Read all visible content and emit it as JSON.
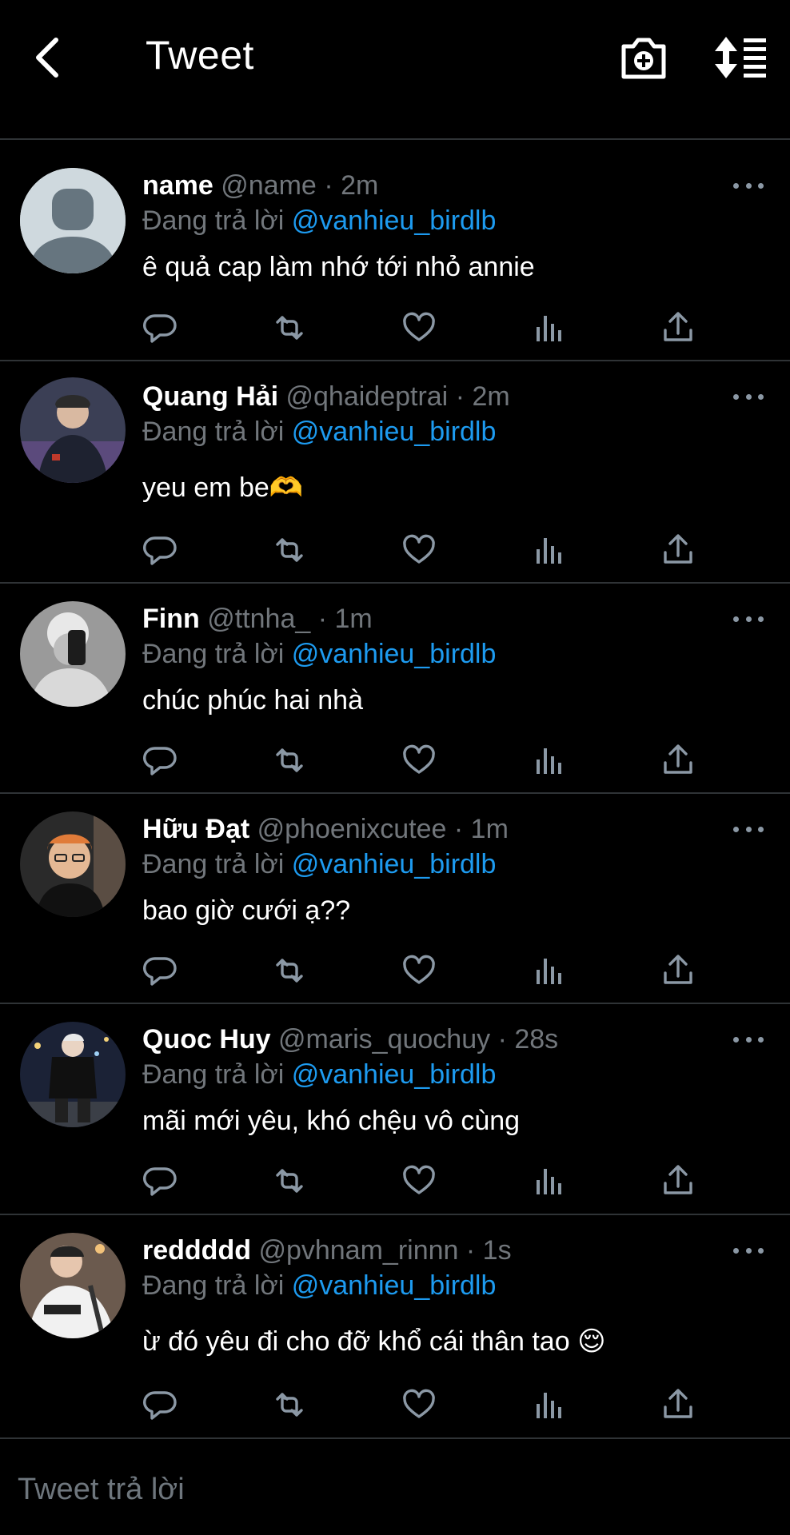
{
  "header": {
    "title": "Tweet"
  },
  "reply_to_label": "Đang trả lời",
  "tweets": [
    {
      "name": "name",
      "handle": "@name",
      "time": "· 2m",
      "mention": "@vanhieu_birdlb",
      "text": "ê quả cap làm nhớ tới nhỏ annie"
    },
    {
      "name": "Quang Hải",
      "handle": "@qhaideptrai",
      "time": "· 2m",
      "mention": "@vanhieu_birdlb",
      "text": "yeu em be🫶"
    },
    {
      "name": "Finn",
      "handle": "@ttnha_",
      "time": "· 1m",
      "mention": "@vanhieu_birdlb",
      "text": "chúc phúc hai nhà"
    },
    {
      "name": "Hữu Đạt",
      "handle": "@phoenixcutee",
      "time": "· 1m",
      "mention": "@vanhieu_birdlb",
      "text": "bao giờ cưới ạ??"
    },
    {
      "name": "Quoc Huy",
      "handle": "@maris_quochuy",
      "time": "· 28s",
      "mention": "@vanhieu_birdlb",
      "text": "mãi mới yêu, khó chệu vô cùng"
    },
    {
      "name": "reddddd",
      "handle": "@pvhnam_rinnn",
      "time": "· 1s",
      "mention": "@vanhieu_birdlb",
      "text": "ừ đó yêu đi cho đỡ khổ cái thân tao 😌"
    }
  ],
  "composer": {
    "placeholder": "Tweet trả lời"
  },
  "colors": {
    "accent": "#1d9bf0",
    "muted": "#71767b",
    "divider": "#2f3336",
    "background": "#000000"
  },
  "icons": [
    "back-icon",
    "camera-plus-icon",
    "sort-icon",
    "reply-icon",
    "retweet-icon",
    "like-icon",
    "views-icon",
    "share-icon",
    "more-icon"
  ]
}
